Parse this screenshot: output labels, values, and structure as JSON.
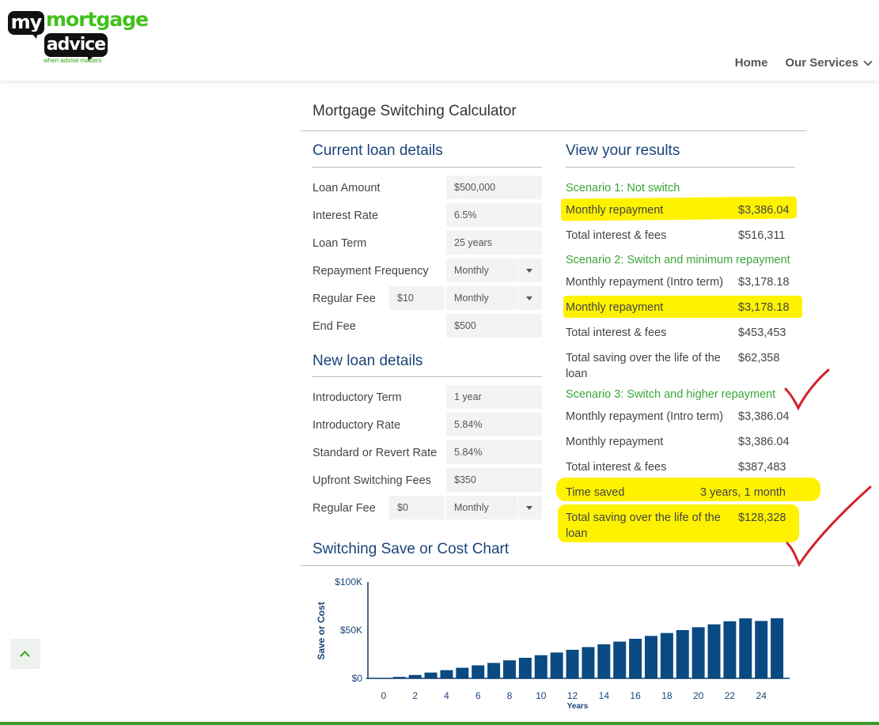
{
  "brand": {
    "logo_my": "my",
    "logo_mortgage": "mortgage",
    "logo_advice": "advice",
    "tagline": "when advise matters",
    "accent": "#3fc11a"
  },
  "nav": {
    "home": "Home",
    "services": "Our Services"
  },
  "calculator": {
    "title": "Mortgage Switching Calculator"
  },
  "current_loan": {
    "title": "Current loan details",
    "rows": [
      {
        "label": "Loan Amount",
        "value": "$500,000"
      },
      {
        "label": "Interest Rate",
        "value": "6.5%"
      },
      {
        "label": "Loan Term",
        "value": "25 years"
      },
      {
        "label": "Repayment Frequency",
        "value": "Monthly"
      },
      {
        "label": "Regular Fee",
        "value": "$10",
        "freq": "Monthly"
      },
      {
        "label": "End Fee",
        "value": "$500"
      }
    ]
  },
  "new_loan": {
    "title": "New loan details",
    "rows": [
      {
        "label": "Introductory Term",
        "value": "1 year"
      },
      {
        "label": "Introductory Rate",
        "value": "5.84%"
      },
      {
        "label": "Standard or Revert Rate",
        "value": "5.84%"
      },
      {
        "label": "Upfront Switching Fees",
        "value": "$350"
      },
      {
        "label": "Regular Fee",
        "value": "$0",
        "freq": "Monthly"
      }
    ]
  },
  "results": {
    "title": "View your results",
    "s1": {
      "heading": "Scenario 1: Not switch",
      "monthly_label": "Monthly repayment",
      "monthly_value": "$3,386.04",
      "interest_label": "Total interest & fees",
      "interest_value": "$516,311"
    },
    "s2": {
      "heading": "Scenario 2: Switch and minimum repayment",
      "intro_label": "Monthly repayment (Intro term)",
      "intro_value": "$3,178.18",
      "monthly_label": "Monthly repayment",
      "monthly_value": "$3,178.18",
      "interest_label": "Total interest & fees",
      "interest_value": "$453,453",
      "saving_label": "Total saving over the life of the loan",
      "saving_value": "$62,358"
    },
    "s3": {
      "heading": "Scenario 3: Switch and higher repayment",
      "intro_label": "Monthly repayment (Intro term)",
      "intro_value": "$3,386.04",
      "monthly_label": "Monthly repayment",
      "monthly_value": "$3,386.04",
      "interest_label": "Total interest & fees",
      "interest_value": "$387,483",
      "time_label": "Time saved",
      "time_value": "3 years, 1 month",
      "saving_label": "Total saving over the life of the loan",
      "saving_value": "$128,328"
    }
  },
  "chart_data": {
    "type": "bar",
    "title": "Switching Save or Cost Chart",
    "xlabel": "Years",
    "ylabel": "Save or Cost",
    "x_ticks": [
      "0",
      "2",
      "4",
      "6",
      "8",
      "10",
      "12",
      "14",
      "16",
      "18",
      "20",
      "22",
      "24"
    ],
    "y_ticks": [
      "$100K",
      "$50K",
      "$0"
    ],
    "ylim": [
      0,
      100000
    ],
    "xlim": [
      -1,
      25.8
    ],
    "categories": [
      1,
      2,
      3,
      4,
      5,
      6,
      7,
      8,
      9,
      10,
      11,
      12,
      13,
      14,
      15,
      16,
      17,
      18,
      19,
      20,
      21,
      22,
      23,
      24,
      25
    ],
    "values": [
      1500,
      3500,
      6000,
      8500,
      11000,
      13500,
      16000,
      18700,
      21300,
      24000,
      26800,
      29600,
      32400,
      35300,
      38100,
      41000,
      44000,
      47000,
      50000,
      53000,
      56000,
      59200,
      62200,
      59500,
      62300
    ],
    "bar_color": "#0a4a82",
    "grid": false,
    "legend": "none"
  }
}
